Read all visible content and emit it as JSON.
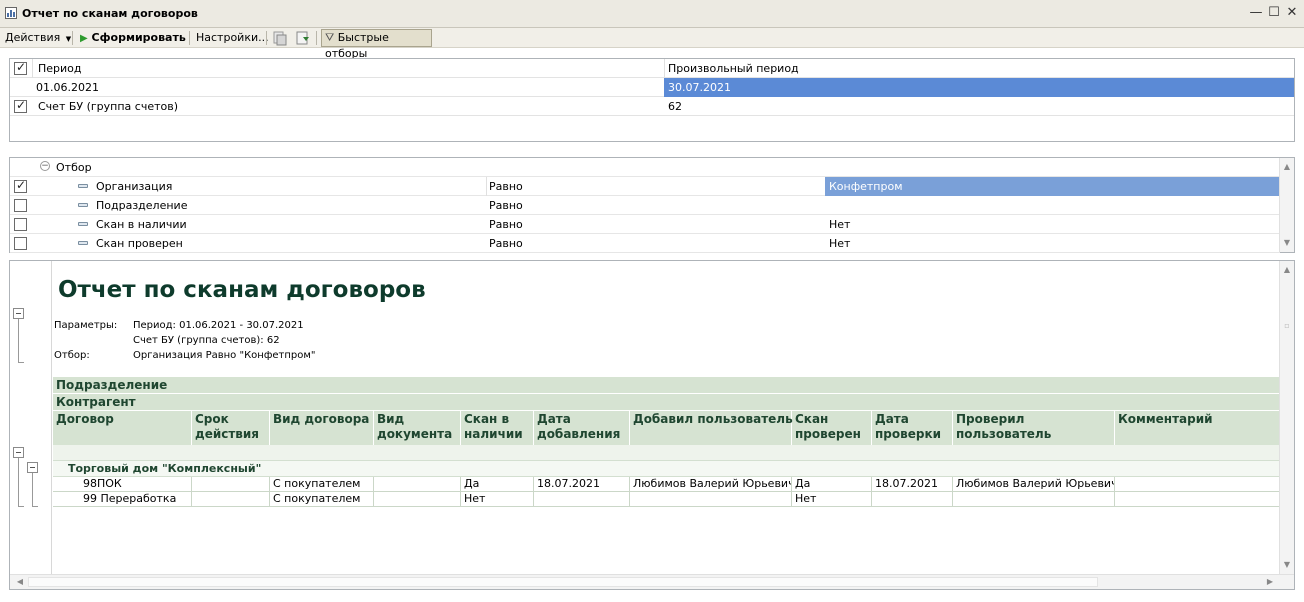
{
  "window": {
    "title": "Отчет по сканам договоров"
  },
  "toolbar": {
    "actions_label": "Действия",
    "generate_label": "Сформировать",
    "settings_label": "Настройки...",
    "quick_filters_label": "Быстрые отборы"
  },
  "params": {
    "period_label": "Период",
    "period_type": "Произвольный период",
    "period_start": "01.06.2021",
    "period_end": "30.07.2021",
    "account_label": "Счет БУ (группа счетов)",
    "account_value": "62"
  },
  "filter": {
    "root_label": "Отбор",
    "rows": [
      {
        "field": "Организация",
        "condition": "Равно",
        "value": "Конфетпром",
        "checked": true
      },
      {
        "field": "Подразделение",
        "condition": "Равно",
        "value": "",
        "checked": false
      },
      {
        "field": "Скан в наличии",
        "condition": "Равно",
        "value": "Нет",
        "checked": false
      },
      {
        "field": "Скан проверен",
        "condition": "Равно",
        "value": "Нет",
        "checked": false
      }
    ]
  },
  "report": {
    "title": "Отчет по сканам договоров",
    "params_label": "Параметры:",
    "param_line1": "Период: 01.06.2021 - 30.07.2021",
    "param_line2": "Счет БУ (группа счетов): 62",
    "filter_label": "Отбор:",
    "filter_line": "Организация Равно \"Конфетпром\"",
    "group1": "Подразделение",
    "group2": "Контрагент",
    "columns": [
      "Договор",
      "Срок\nдействия",
      "Вид договора",
      "Вид\nдокумента",
      "Скан в\nналичии",
      "Дата\nдобавления",
      "Добавил пользователь",
      "Скан\nпроверен",
      "Дата\nпроверки",
      "Проверил\nпользователь",
      "Комментарий"
    ],
    "counterparty": "Торговый дом \"Комплексный\"",
    "rows": [
      [
        "98ПОК",
        "",
        "С покупателем",
        "",
        "Да",
        "18.07.2021",
        "Любимов Валерий Юрьевич",
        "Да",
        "18.07.2021",
        "Любимов Валерий Юрьевич",
        ""
      ],
      [
        "99 Переработка",
        "",
        "С покупателем",
        "",
        "Нет",
        "",
        "",
        "Нет",
        "",
        "",
        ""
      ]
    ]
  },
  "colors": {
    "selection": "#5b8ad6",
    "header_band": "#d6e3d2",
    "header_text": "#1f4630"
  }
}
